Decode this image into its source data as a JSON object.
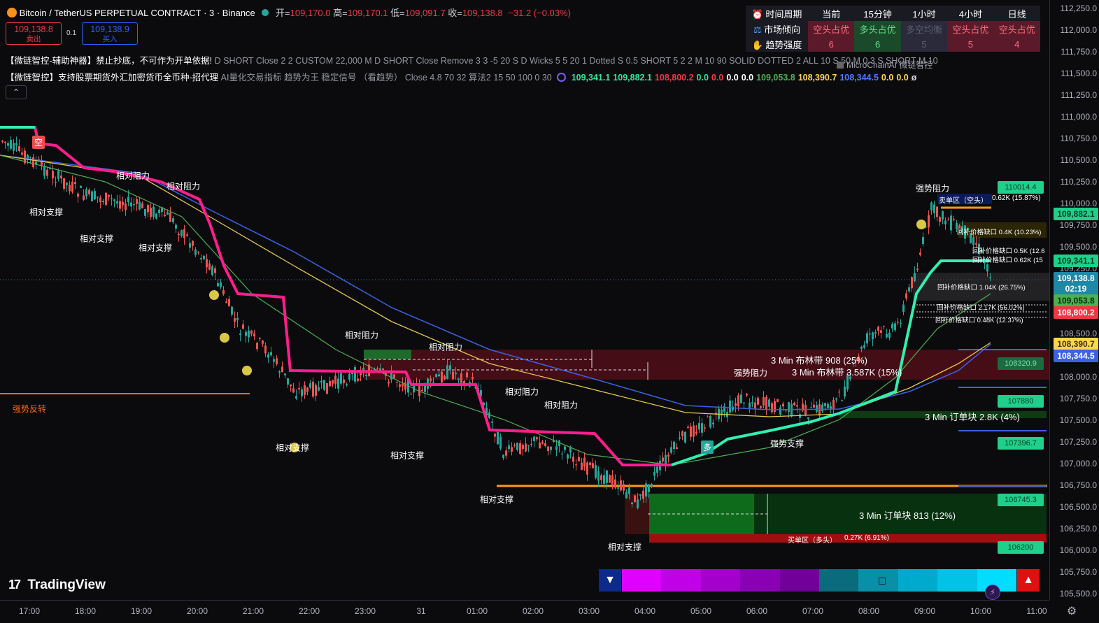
{
  "header": {
    "symbol_title": "Bitcoin / TetherUS PERPETUAL CONTRACT · 3 · Binance",
    "open_label": "开=",
    "open_value": "109,170.0",
    "high_label": "高=",
    "high_value": "109,170.1",
    "low_label": "低=",
    "low_value": "109,091.7",
    "close_label": "收=",
    "close_value": "109,138.8",
    "change": "−31.2 (−0.03%)"
  },
  "trade": {
    "sell_price": "109,138.8",
    "sell_label": "卖出",
    "spread": "0.1",
    "buy_price": "109,138.9",
    "buy_label": "买入"
  },
  "indicators": {
    "row1_name": "【微链智控-辅助神器】禁止抄底，不可作为开单依据!",
    "row1_params": "D SHORT Close 2 2 CUSTOM 22,000 M D SHORT Close Remove 3 3 -5 20 S D Wicks 5 5 20 1 Dotted S 0.5 SHORT 5 2 2 M 10 90 SOLID DOTTED 2 ALL 10 S 50 M 0.3 S SHORT M 10",
    "row2_name": "【微链智控】支持股票期货外汇加密货币全币种-招代理",
    "row2_params": "AI量化交易指标 趋势为王 稳定信号 （看趋势） Close 4.8 70 32 算法2 15 50 100 0 30",
    "row2_values": [
      {
        "text": "109,341.1",
        "color": "#2fe6a0"
      },
      {
        "text": "109,882.1",
        "color": "#2fe6a0"
      },
      {
        "text": "108,800.2",
        "color": "#f23645"
      },
      {
        "text": "0.0",
        "color": "#2fe6a0"
      },
      {
        "text": "0.0",
        "color": "#f23645"
      },
      {
        "text": "0.0",
        "color": "#ffffff"
      },
      {
        "text": "0.0",
        "color": "#ffffff"
      },
      {
        "text": "109,053.8",
        "color": "#4caf50"
      },
      {
        "text": "108,390.7",
        "color": "#ffd54f"
      },
      {
        "text": "108,344.5",
        "color": "#4a7cff"
      },
      {
        "text": "0.0",
        "color": "#ffd54f"
      },
      {
        "text": "0.0",
        "color": "#ffd54f"
      },
      {
        "text": "ø",
        "color": "#d1d4dc"
      }
    ],
    "watermark": "MicroChainAI 微链智控",
    "collapse_icon": "chevron-up-icon"
  },
  "mtf_table": {
    "headers": [
      "时间周期",
      "当前",
      "15分钟",
      "1小时",
      "4小时",
      "日线"
    ],
    "trend_label": "市场倾向",
    "trend_values": [
      "空头占优",
      "多头占优",
      "多空均衡",
      "空头占优",
      "空头占优"
    ],
    "strength_label": "趋势强度",
    "strength_values": [
      "6",
      "6",
      "5",
      "5",
      "4"
    ]
  },
  "y_axis": {
    "ticks": [
      "112,250.0",
      "112,000.0",
      "111,750.0",
      "111,500.0",
      "111,250.0",
      "111,000.0",
      "110,750.0",
      "110,500.0",
      "110,250.0",
      "110,000.0",
      "109,750.0",
      "109,500.0",
      "109,250.0",
      "109,000.0",
      "108,750.0",
      "108,500.0",
      "108,250.0",
      "108,000.0",
      "107,750.0",
      "107,500.0",
      "107,250.0",
      "107,000.0",
      "106,750.0",
      "106,500.0",
      "106,250.0",
      "106,000.0",
      "105,750.0",
      "105,500.0"
    ],
    "tags": [
      {
        "text": "109,882.1",
        "bg": "#1fd08a",
        "fg": "#0b3b2a"
      },
      {
        "text": "109,341.1",
        "bg": "#1fd08a",
        "fg": "#0b3b2a"
      },
      {
        "text": "109,138.8",
        "bg": "#1e88a8",
        "fg": "#ffffff"
      },
      {
        "text": "02:19",
        "bg": "#1e88a8",
        "fg": "#ffffff"
      },
      {
        "text": "109,053.8",
        "bg": "#4caf50",
        "fg": "#0b2a10"
      },
      {
        "text": "108,800.2",
        "bg": "#f23645",
        "fg": "#ffffff"
      },
      {
        "text": "108,390.7",
        "bg": "#ffd54f",
        "fg": "#3a2f00"
      },
      {
        "text": "108,344.5",
        "bg": "#3b63e0",
        "fg": "#ffffff"
      }
    ]
  },
  "x_axis": {
    "ticks": [
      "17:00",
      "18:00",
      "19:00",
      "20:00",
      "21:00",
      "22:00",
      "23:00",
      "31",
      "01:00",
      "02:00",
      "03:00",
      "04:00",
      "05:00",
      "06:00",
      "07:00",
      "08:00",
      "09:00",
      "10:00",
      "11:00"
    ]
  },
  "right_tags": [
    "110014.4",
    "108320.9",
    "107880",
    "107396.7",
    "106745.3",
    "106200"
  ],
  "chart_labels": {
    "rel_resistance": "相对阻力",
    "rel_support": "相对支撑",
    "strong_resistance": "强势阻力",
    "strong_support": "强势支撑",
    "strong_reversal": "强势反转",
    "short_tag": "空",
    "long_tag": "多",
    "bollinger_1": "3 Min 布林带 908 (25%)",
    "bollinger_2": "3 Min 布林带 3.587K (15%)",
    "orderblock_1": "3 Min 订单块 2.8K (4%)",
    "orderblock_2": "3 Min 订单块 813 (12%)",
    "sell_zone": "卖单区（空头）",
    "sell_zone_val": "0.62K (15.87%)",
    "buy_zone": "买单区（多头）",
    "buy_zone_val": "0.27K (6.91%)",
    "gap_1": "回补价格缺口 0.4K (10.23%)",
    "gap_2": "回补价格缺口 0.5K (12.6",
    "gap_3": "回补价格缺口 0.62K (15",
    "gap_4": "回补价格缺口 1.04K (26.75%)",
    "gap_5": "回补价格缺口 2.17K (56.02%)",
    "gap_6": "回补价格缺口 0.48K (12.37%)"
  },
  "sentiment_bar": {
    "colors": [
      "#e100ff",
      "#c000e6",
      "#a300cc",
      "#8a00b3",
      "#700099",
      "#0a6b7d",
      "#0a8fa8",
      "#00aacc",
      "#00c3e6",
      "#00ddff"
    ],
    "mid_icon": "square-icon"
  },
  "branding": {
    "logo_text": "TradingView"
  },
  "colors": {
    "bull": "#26a69a",
    "bear": "#ef5350",
    "trend_pink": "#ff1e8c",
    "trend_green": "#30f0b0"
  }
}
